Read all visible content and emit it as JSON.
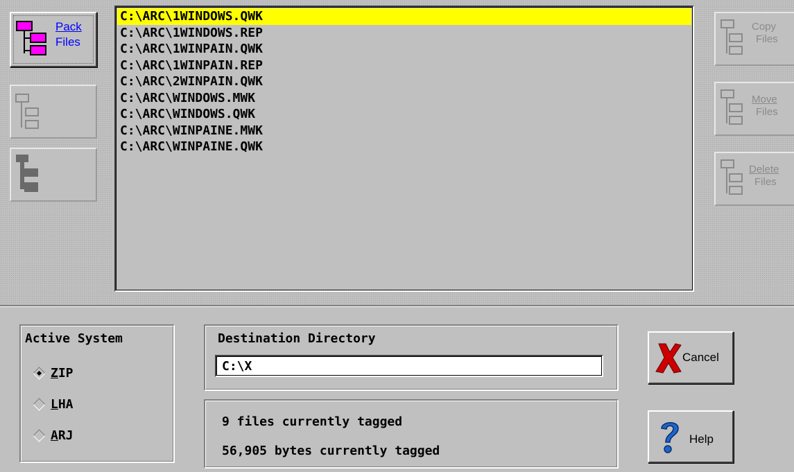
{
  "toolbar": {
    "pack": {
      "line1": "Pack",
      "line2": "Files",
      "icon": "pack-files-icon"
    },
    "tag": {
      "icon": "tag-files-icon"
    },
    "untag": {
      "icon": "untag-files-icon"
    },
    "copy": {
      "line1": "Copy",
      "line2": "Files",
      "icon": "copy-files-icon"
    },
    "move": {
      "line1": "Move",
      "line2": "Files",
      "icon": "move-files-icon"
    },
    "delete": {
      "line1": "Delete",
      "line2": "Files",
      "icon": "delete-files-icon"
    }
  },
  "files": [
    "C:\\ARC\\1WINDOWS.QWK",
    "C:\\ARC\\1WINDOWS.REP",
    "C:\\ARC\\1WINPAIN.QWK",
    "C:\\ARC\\1WINPAIN.REP",
    "C:\\ARC\\2WINPAIN.QWK",
    "C:\\ARC\\WINDOWS.MWK",
    "C:\\ARC\\WINDOWS.QWK",
    "C:\\ARC\\WINPAINE.MWK",
    "C:\\ARC\\WINPAINE.QWK"
  ],
  "selected_file_index": 0,
  "active_system": {
    "title": "Active System",
    "options": [
      {
        "hotkey": "Z",
        "rest": "IP",
        "selected": true
      },
      {
        "hotkey": "L",
        "rest": "HA",
        "selected": false
      },
      {
        "hotkey": "A",
        "rest": "RJ",
        "selected": false
      }
    ]
  },
  "destination": {
    "title": "Destination Directory",
    "value": "C:\\X"
  },
  "status": {
    "files_tagged": "9 files currently tagged",
    "bytes_tagged": "56,905 bytes currently tagged"
  },
  "buttons": {
    "cancel": "Cancel",
    "help": "Help"
  },
  "colors": {
    "face": "#c0c0c0",
    "selection": "#ffff00",
    "pack_icon": "#ff00ff",
    "cancel_icon": "#cc0000",
    "help_icon": "#1e66c8"
  }
}
